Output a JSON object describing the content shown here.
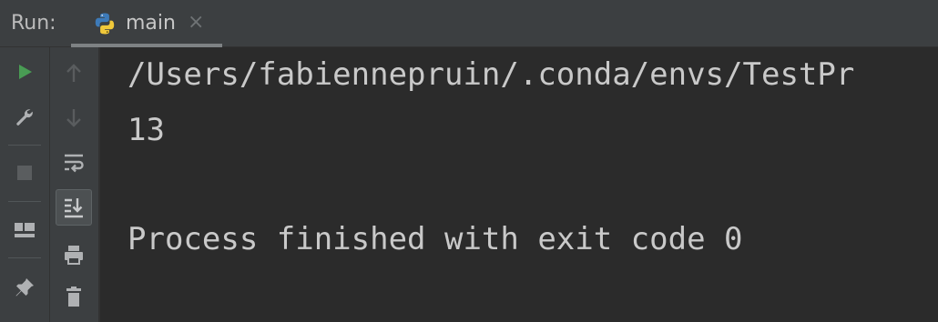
{
  "header": {
    "run_label": "Run:",
    "tab": {
      "label": "main",
      "close_glyph": "×",
      "icon": "python-icon"
    }
  },
  "toolbar_left": [
    {
      "name": "run-button",
      "icon": "play-icon",
      "color": "#499c54"
    },
    {
      "name": "settings-button",
      "icon": "wrench-icon"
    },
    {
      "name": "stop-button",
      "icon": "stop-icon",
      "enabled": false
    },
    {
      "name": "layout-button",
      "icon": "layout-icon"
    },
    {
      "name": "pin-button",
      "icon": "pin-icon"
    }
  ],
  "toolbar_right": [
    {
      "name": "up-button",
      "icon": "arrow-up-icon",
      "enabled": false
    },
    {
      "name": "down-button",
      "icon": "arrow-down-icon",
      "enabled": false
    },
    {
      "name": "soft-wrap-button",
      "icon": "soft-wrap-icon"
    },
    {
      "name": "scroll-to-end-button",
      "icon": "scroll-to-end-icon",
      "active": true
    },
    {
      "name": "print-button",
      "icon": "print-icon"
    },
    {
      "name": "clear-button",
      "icon": "trash-icon"
    }
  ],
  "console": {
    "lines": [
      "/Users/fabiennepruin/.conda/envs/TestPr",
      "13",
      "",
      "Process finished with exit code 0"
    ]
  },
  "colors": {
    "background": "#2b2b2b",
    "toolbar": "#3c3f41",
    "text": "#c9c9c9",
    "run_green": "#499c54"
  }
}
